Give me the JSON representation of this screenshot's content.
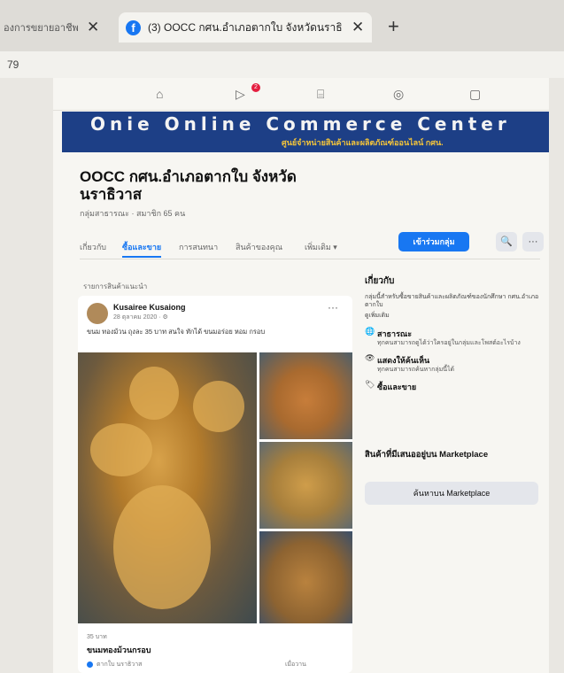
{
  "browser": {
    "tabs": [
      {
        "label": "องการขยายอาชีพ",
        "close": "✕"
      },
      {
        "label": "(3) OOCC กศน.อำเภอตากใบ จังหวัดนราธิวาส",
        "close": "✕"
      }
    ],
    "new_tab": "+",
    "address_text": "79"
  },
  "cover": {
    "title": "Onie Online Commerce Center",
    "subtitle": "ศูนย์จำหน่ายสินค้าและผลิตภัณฑ์ออนไลน์ กศน."
  },
  "group": {
    "name": "OOCC กศน.อำเภอตากใบ จังหวัดนราธิวาส",
    "meta": "กลุ่มสาธารณะ · สมาชิก 65 คน",
    "tabs": [
      "เกี่ยวกับ",
      "ซื้อและขาย",
      "การสนทนา",
      "สินค้าของคุณ",
      "เพิ่มเติม ▾"
    ],
    "join_label": "เข้าร่วมกลุ่ม",
    "search_icon": "🔍",
    "more_label": "···"
  },
  "feed": {
    "section_label": "รายการสินค้าแนะนำ",
    "post": {
      "author": "Kusairee Kusaiong",
      "date": "28 ตุลาคม 2020 · ⚙",
      "menu": "···",
      "text": "ขนม ทองม้วน ถุงละ 35 บาท สนใจ ทักได้ ขนมอร่อย หอม กรอบ",
      "small": "35 บาท",
      "title": "ขนมทองม้วนกรอบ",
      "location": "ตากใบ นราธิวาส",
      "footer_right": "เมื่อวาน"
    }
  },
  "about": {
    "heading": "เกี่ยวกับ",
    "description": "กลุ่มนี้สำหรับซื้อขายสินค้าและผลิตภัณฑ์ของนักศึกษา กศน.อำเภอตากใบ",
    "see_more": "ดูเพิ่มเติม",
    "rows": [
      {
        "icon": "🌐",
        "title": "สาธารณะ",
        "text": "ทุกคนสามารถดูได้ว่าใครอยู่ในกลุ่มและโพสต์อะไรบ้าง"
      },
      {
        "icon": "👁",
        "title": "แสดงให้ค้นเห็น",
        "text": "ทุกคนสามารถค้นหากลุ่มนี้ได้"
      },
      {
        "icon": "🏷",
        "title": "ซื้อและขาย",
        "text": ""
      }
    ]
  },
  "marketplace": {
    "title": "สินค้าที่มีเสนออยู่บน Marketplace",
    "button": "ค้นหาบน Marketplace"
  },
  "nav_icons": [
    "home-icon",
    "video-icon",
    "marketplace-icon",
    "groups-icon",
    "gaming-icon"
  ],
  "colors": {
    "accent": "#1877f2",
    "cover_bg": "#1d3f86",
    "cover_sub": "#f3c43a"
  }
}
